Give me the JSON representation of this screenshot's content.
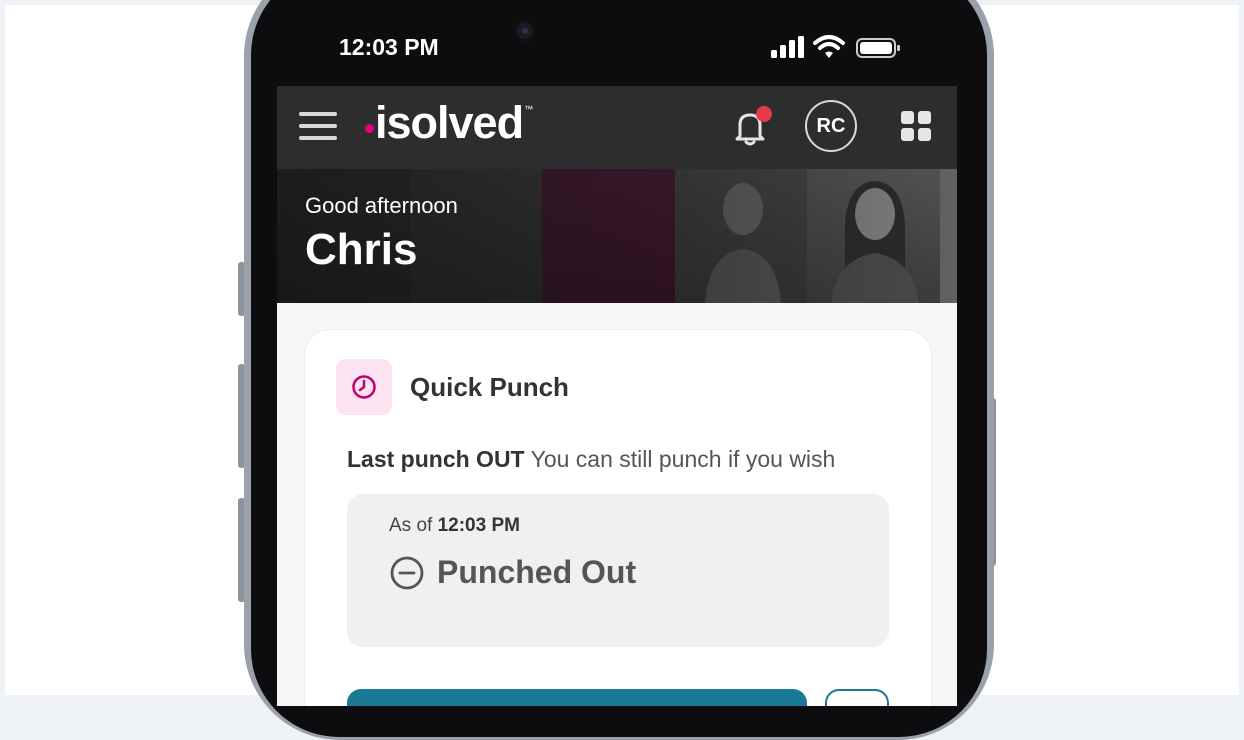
{
  "status_bar": {
    "time": "12:03 PM"
  },
  "header": {
    "logo_text": "isolved",
    "logo_tm": "™",
    "avatar_initials": "RC",
    "colors": {
      "brand": "#e6007e",
      "header_bg": "#2d2d2d",
      "notification_dot": "#e8394a"
    }
  },
  "banner": {
    "greeting": "Good afternoon",
    "name": "Chris"
  },
  "quick_punch": {
    "title": "Quick Punch",
    "last_punch_label": "Last punch OUT",
    "last_punch_note": "You can still punch if you wish",
    "as_of_label": "As of",
    "as_of_time": "12:03 PM",
    "state": "Punched Out",
    "colors": {
      "accent": "#e6007e",
      "button": "#1a7a96"
    }
  }
}
